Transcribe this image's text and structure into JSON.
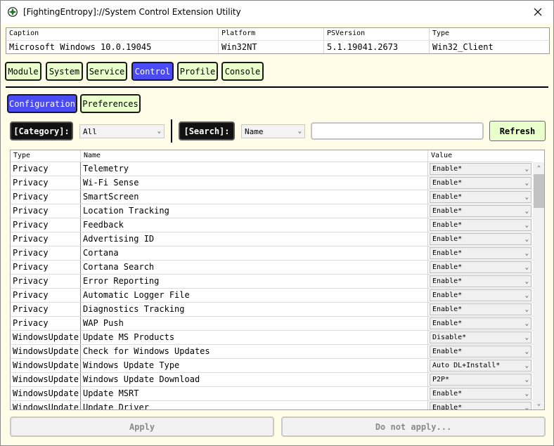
{
  "window": {
    "title": "[FightingEntropy]://System Control Extension Utility"
  },
  "info": {
    "headers": [
      "Caption",
      "Platform",
      "PSVersion",
      "Type"
    ],
    "values": [
      "Microsoft Windows 10.0.19045",
      "Win32NT",
      "5.1.19041.2673",
      "Win32_Client"
    ]
  },
  "main_tabs": [
    "Module",
    "System",
    "Service",
    "Control",
    "Profile",
    "Console"
  ],
  "active_main_tab": "Control",
  "sub_tabs": [
    "Configuration",
    "Preferences"
  ],
  "active_sub_tab": "Configuration",
  "filter": {
    "category_label": "[Category]:",
    "category_value": "All",
    "search_label": "[Search]:",
    "search_field": "Name",
    "search_text": "",
    "refresh_label": "Refresh"
  },
  "grid": {
    "headers": [
      "Type",
      "Name",
      "Value"
    ],
    "rows": [
      {
        "type": "Privacy",
        "name": "Telemetry",
        "value": "Enable*"
      },
      {
        "type": "Privacy",
        "name": "Wi-Fi Sense",
        "value": "Enable*"
      },
      {
        "type": "Privacy",
        "name": "SmartScreen",
        "value": "Enable*"
      },
      {
        "type": "Privacy",
        "name": "Location Tracking",
        "value": "Enable*"
      },
      {
        "type": "Privacy",
        "name": "Feedback",
        "value": "Enable*"
      },
      {
        "type": "Privacy",
        "name": "Advertising ID",
        "value": "Enable*"
      },
      {
        "type": "Privacy",
        "name": "Cortana",
        "value": "Enable*"
      },
      {
        "type": "Privacy",
        "name": "Cortana Search",
        "value": "Enable*"
      },
      {
        "type": "Privacy",
        "name": "Error Reporting",
        "value": "Enable*"
      },
      {
        "type": "Privacy",
        "name": "Automatic Logger File",
        "value": "Enable*"
      },
      {
        "type": "Privacy",
        "name": "Diagnostics Tracking",
        "value": "Enable*"
      },
      {
        "type": "Privacy",
        "name": "WAP Push",
        "value": "Enable*"
      },
      {
        "type": "WindowsUpdate",
        "name": "Update MS Products",
        "value": "Disable*"
      },
      {
        "type": "WindowsUpdate",
        "name": "Check for Windows Updates",
        "value": "Enable*"
      },
      {
        "type": "WindowsUpdate",
        "name": "Windows Update Type",
        "value": "Auto DL+Install*"
      },
      {
        "type": "WindowsUpdate",
        "name": "Windows Update Download",
        "value": "P2P*"
      },
      {
        "type": "WindowsUpdate",
        "name": "Update MSRT",
        "value": "Enable*"
      },
      {
        "type": "WindowsUpdate",
        "name": "Update Driver",
        "value": "Enable*"
      }
    ]
  },
  "actions": {
    "apply": "Apply",
    "do_not_apply": "Do not apply..."
  },
  "colors": {
    "active_tab": "#4b4bf4",
    "tab_bg": "#e9ffcc",
    "window_bg": "#fffde8"
  }
}
